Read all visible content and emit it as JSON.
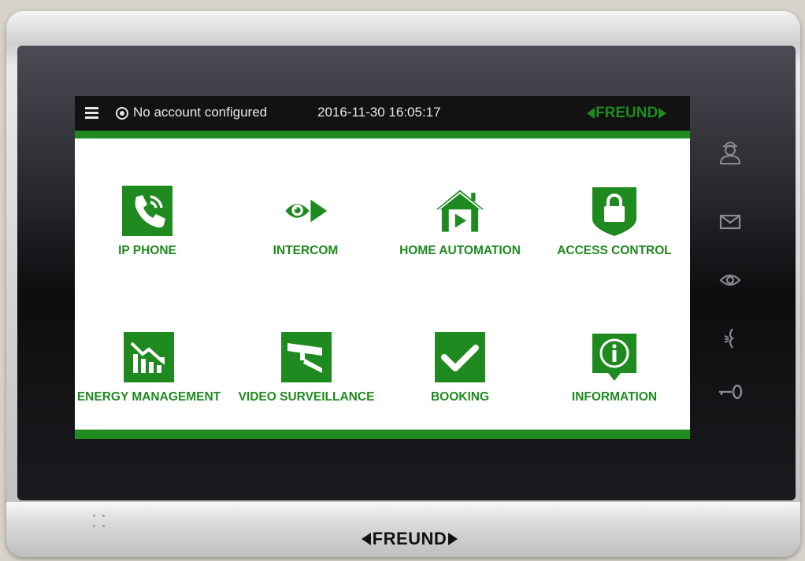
{
  "status_bar": {
    "account_status": "No account configured",
    "datetime": "2016-11-30 16:05:17",
    "brand": "FREUND"
  },
  "tiles": [
    {
      "label": "IP PHONE",
      "icon": "phone-icon"
    },
    {
      "label": "INTERCOM",
      "icon": "eye-icon"
    },
    {
      "label": "HOME AUTOMATION",
      "icon": "house-play-icon"
    },
    {
      "label": "ACCESS CONTROL",
      "icon": "lock-shield-icon"
    },
    {
      "label": "ENERGY MANAGEMENT",
      "icon": "chart-down-icon"
    },
    {
      "label": "VIDEO SURVEILLANCE",
      "icon": "camera-icon"
    },
    {
      "label": "BOOKING",
      "icon": "checkmark-icon"
    },
    {
      "label": "INFORMATION",
      "icon": "info-icon"
    }
  ],
  "side_buttons": [
    "user-icon",
    "mail-icon",
    "eye-icon",
    "bell-icon",
    "key-icon"
  ],
  "device": {
    "brand": "FREUND"
  },
  "colors": {
    "accent": "#1f8a1f",
    "status_bar_bg": "#121212",
    "screen_bg": "#ffffff"
  }
}
